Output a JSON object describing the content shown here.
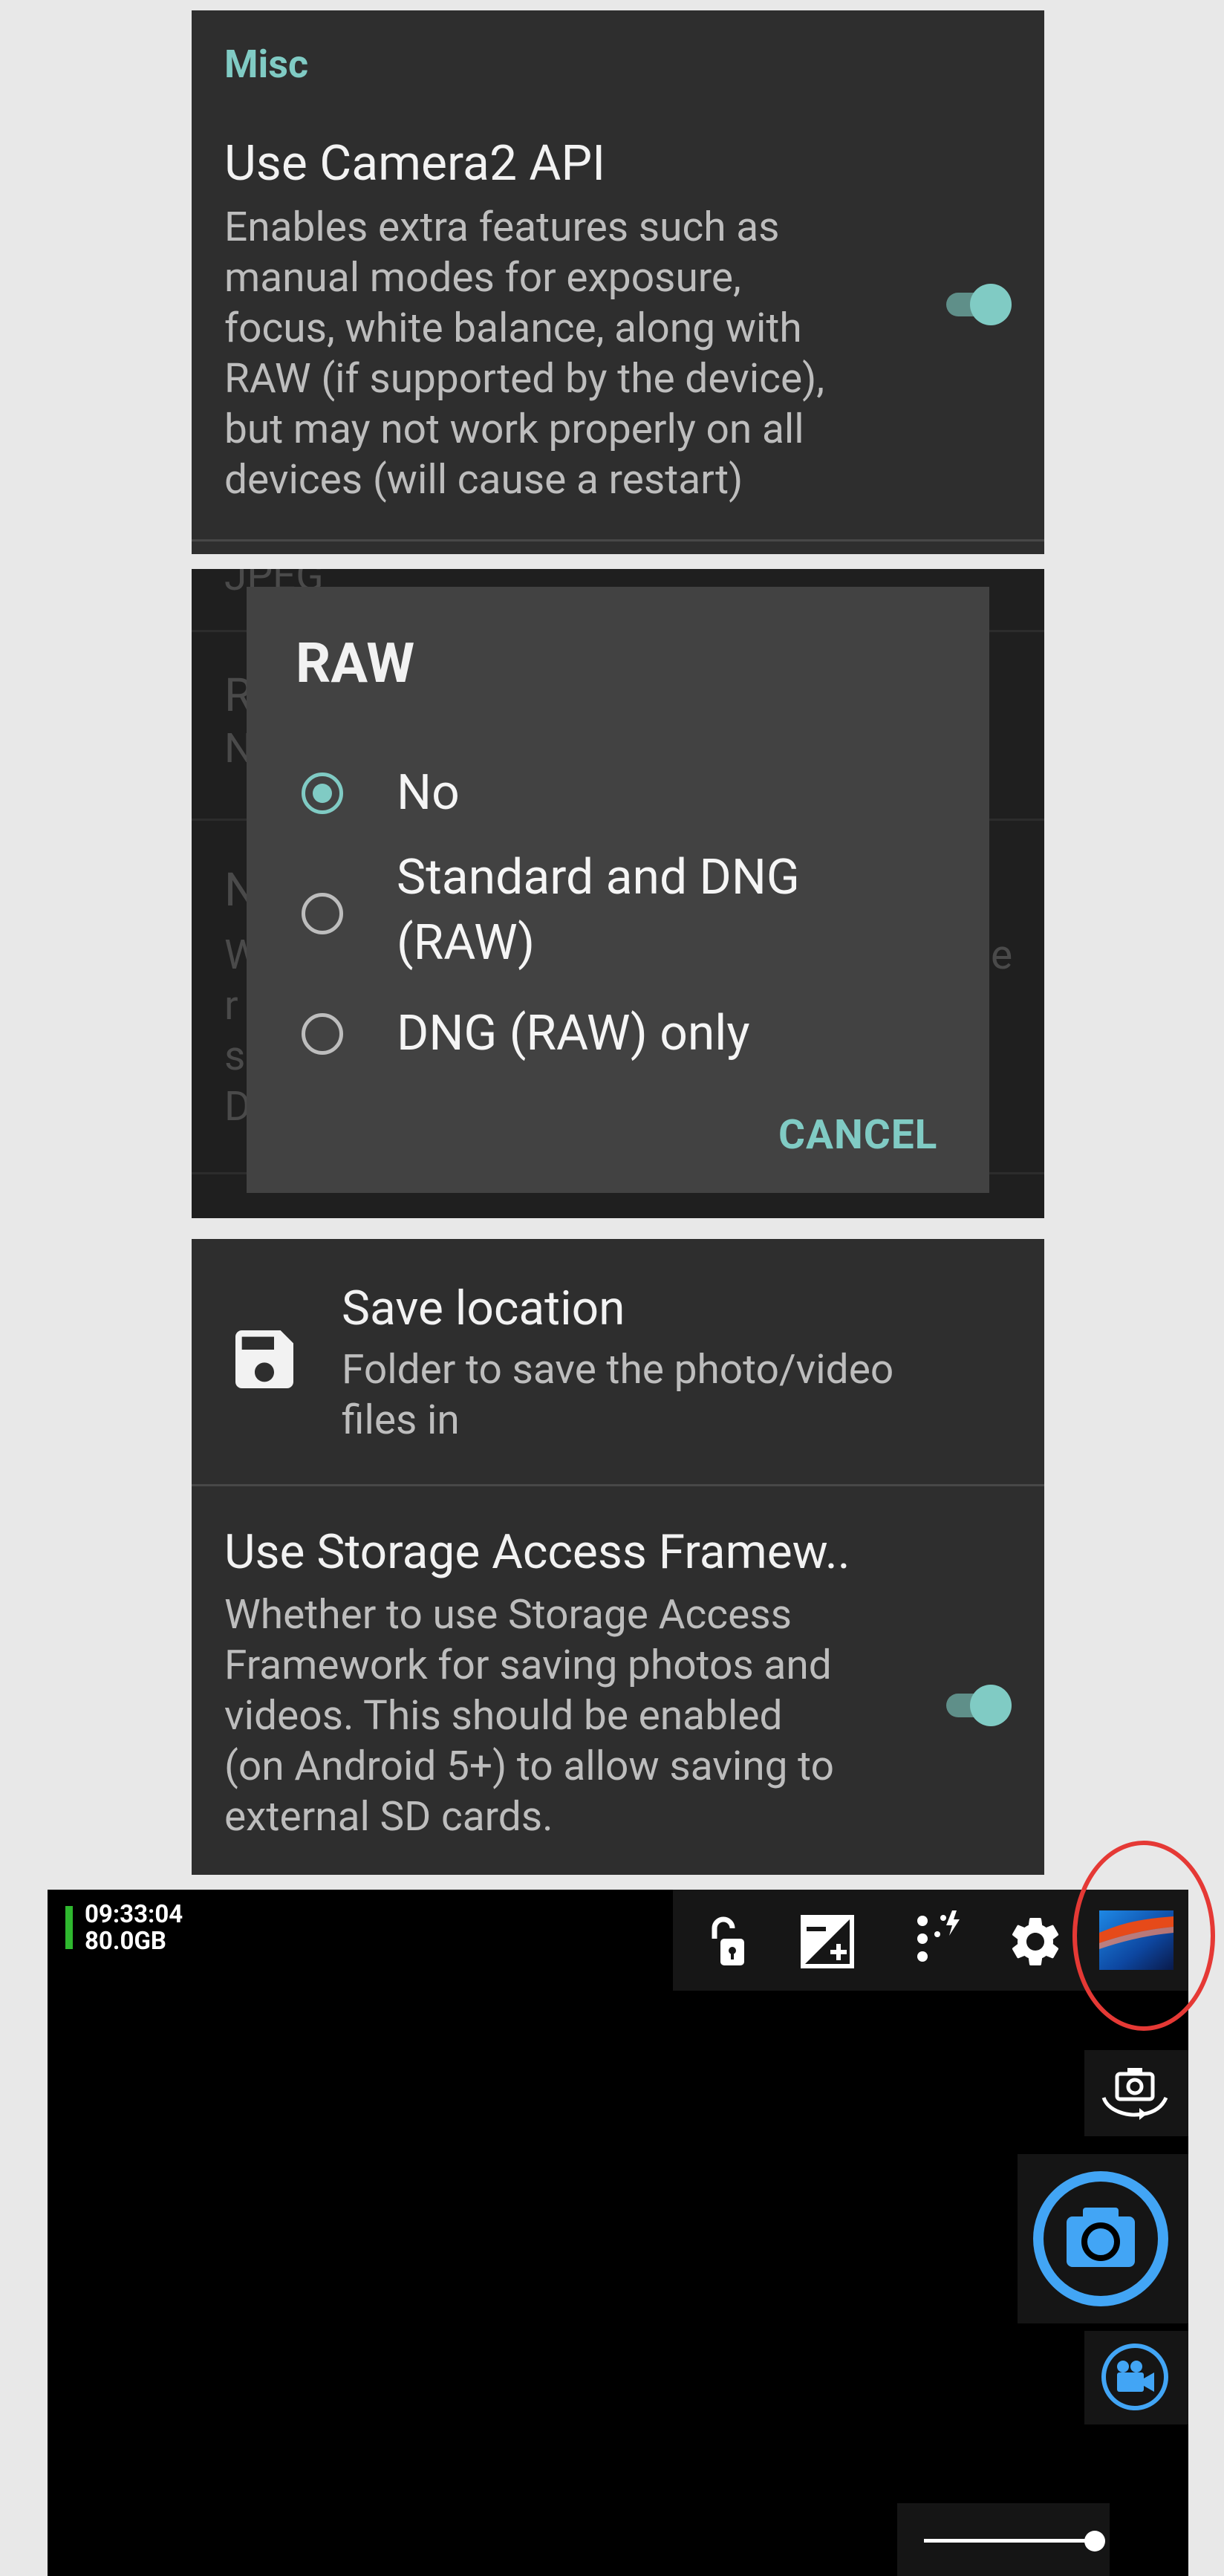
{
  "misc_panel": {
    "section_header": "Misc",
    "camera2": {
      "title": "Use Camera2 API",
      "description_lines": [
        "Enables extra features such as",
        "manual modes for exposure,",
        "focus, white balance, along with",
        "RAW (if supported by the device),",
        "but may not work properly on all",
        "devices (will cause a restart)"
      ],
      "enabled": true
    }
  },
  "raw_dialog": {
    "title": "RAW",
    "options": [
      {
        "label_lines": [
          "No"
        ],
        "selected": true
      },
      {
        "label_lines": [
          "Standard and DNG",
          "(RAW)"
        ],
        "selected": false
      },
      {
        "label_lines": [
          "DNG (RAW) only"
        ],
        "selected": false
      }
    ],
    "cancel_label": "CANCEL",
    "background_text": [
      "JPEG",
      "R",
      "N",
      "N",
      "W",
      "r",
      "s",
      "D",
      "e"
    ]
  },
  "storage_panel": {
    "save_location": {
      "title": "Save location",
      "description_lines": [
        "Folder to save the photo/video",
        "files in"
      ],
      "icon": "floppy-disk-icon"
    },
    "saf": {
      "title": "Use Storage Access Framew..",
      "description_lines": [
        "Whether to use Storage Access",
        "Framework for saving photos and",
        "videos. This should be enabled",
        "(on Android 5+) to allow saving to",
        "external SD cards."
      ],
      "enabled": true
    }
  },
  "camera_view": {
    "time": "09:33:04",
    "free_space": "80.0GB",
    "toolbar_icons": [
      "unlock-icon",
      "exposure-icon",
      "flash-auto-icon",
      "gear-icon",
      "gallery-thumbnail-icon"
    ],
    "side_icons": [
      "switch-camera-icon",
      "shutter-button-icon",
      "video-mode-icon"
    ],
    "accent_color": "#42a5f5",
    "highlight_color": "#e53935"
  }
}
